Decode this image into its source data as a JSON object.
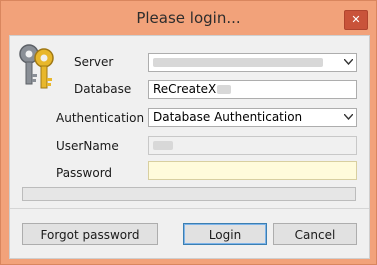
{
  "window": {
    "title": "Please login...",
    "close_glyph": "✕"
  },
  "form": {
    "server_label": "Server",
    "database_label": "Database",
    "database_value": "ReCreateX",
    "authentication_label": "Authentication",
    "authentication_value": "Database Authentication",
    "username_label": "UserName",
    "password_label": "Password"
  },
  "buttons": {
    "forgot": "Forgot password",
    "login": "Login",
    "cancel": "Cancel"
  },
  "icons": {
    "app": "keys-icon",
    "dropdown": "chevron-down-icon"
  },
  "colors": {
    "title_bar": "#f2a27a",
    "password_bg": "#fffbdb"
  }
}
